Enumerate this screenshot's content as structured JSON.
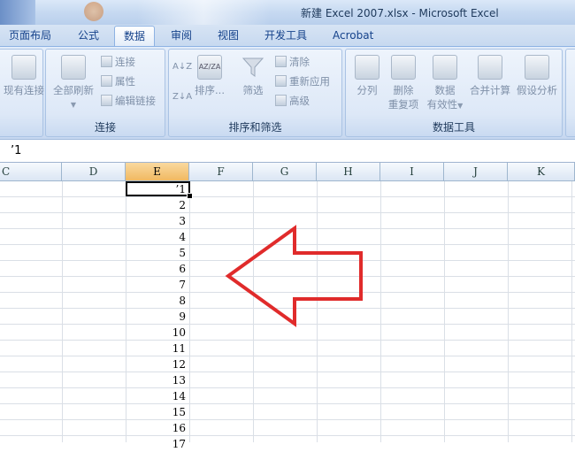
{
  "window": {
    "title": "新建 Excel 2007.xlsx - Microsoft Excel"
  },
  "tabs": [
    {
      "label": "页面布局",
      "active": false
    },
    {
      "label": "公式",
      "active": false
    },
    {
      "label": "数据",
      "active": true
    },
    {
      "label": "审阅",
      "active": false
    },
    {
      "label": "视图",
      "active": false
    },
    {
      "label": "开发工具",
      "active": false
    },
    {
      "label": "Acrobat",
      "active": false
    }
  ],
  "ribbon": {
    "connections_group": {
      "label": "连接",
      "existing_connections": "现有连接",
      "refresh_all": "全部刷新",
      "connections": "连接",
      "properties": "属性",
      "edit_links": "编辑链接"
    },
    "sort_filter_group": {
      "label": "排序和筛选",
      "sort": "排序...",
      "filter": "筛选",
      "clear": "清除",
      "reapply": "重新应用",
      "advanced": "高级",
      "sort_az": "A↓Z",
      "sort_za": "Z↓A",
      "sort_box_letters": "AZ/ZA"
    },
    "data_tools_group": {
      "label": "数据工具",
      "text_to_columns": "分列",
      "remove_duplicates_1": "删除",
      "remove_duplicates_2": "重复项",
      "data_validation_1": "数据",
      "data_validation_2": "有效性",
      "consolidate": "合并计算",
      "what_if": "假设分析"
    }
  },
  "formula_bar": {
    "content": "’1"
  },
  "columns": [
    "C",
    "D",
    "E",
    "F",
    "G",
    "H",
    "I",
    "J",
    "K"
  ],
  "selected_column": "E",
  "cells": [
    "’1",
    "2",
    "3",
    "4",
    "5",
    "6",
    "7",
    "8",
    "9",
    "10",
    "11",
    "12",
    "13",
    "14",
    "15",
    "16",
    "17"
  ],
  "colors": {
    "arrow": "#e02b2b",
    "selected_header": "#f1b961",
    "ribbon_text": "#15428b"
  }
}
